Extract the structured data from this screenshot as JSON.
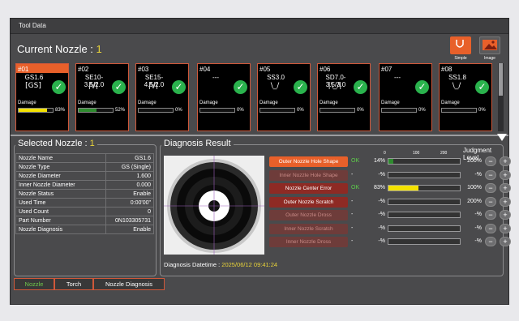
{
  "window": {
    "title": "Tool Data"
  },
  "header": {
    "label": "Current Nozzle : ",
    "value": "1"
  },
  "toolbar": {
    "simple_label": "Simple",
    "image_label": "Image"
  },
  "nozzles": [
    {
      "num": "#01",
      "name": "GS1.6",
      "shape": "[GS]",
      "damage_label": "Damage",
      "pct": "83%",
      "fill": 0.83,
      "fill_color": "#f3e100",
      "selected": true
    },
    {
      "num": "#02",
      "name": "SE10-3.5/2.0",
      "shape": "|\\/|",
      "damage_label": "Damage",
      "pct": "52%",
      "fill": 0.52,
      "fill_color": "#2e8b2e",
      "selected": false
    },
    {
      "num": "#03",
      "name": "SE15-4.5/2.0",
      "shape": "|\\/|",
      "damage_label": "Damage",
      "pct": "0%",
      "fill": 0,
      "fill_color": "#2e8b2e",
      "selected": false
    },
    {
      "num": "#04",
      "name": "---",
      "shape": "",
      "damage_label": "Damage",
      "pct": "0%",
      "fill": 0,
      "fill_color": "#2e8b2e",
      "selected": false
    },
    {
      "num": "#05",
      "name": "SS3.0",
      "shape": "\\_/",
      "damage_label": "Damage",
      "pct": "0%",
      "fill": 0,
      "fill_color": "#2e8b2e",
      "selected": false
    },
    {
      "num": "#06",
      "name": "SD7.0-3.5/3.0",
      "shape": "|\\_/|",
      "damage_label": "Damage",
      "pct": "0%",
      "fill": 0,
      "fill_color": "#2e8b2e",
      "selected": false
    },
    {
      "num": "#07",
      "name": "---",
      "shape": "",
      "damage_label": "Damage",
      "pct": "0%",
      "fill": 0,
      "fill_color": "#2e8b2e",
      "selected": false
    },
    {
      "num": "#08",
      "name": "SS1.8",
      "shape": "\\_/",
      "damage_label": "Damage",
      "pct": "0%",
      "fill": 0,
      "fill_color": "#2e8b2e",
      "selected": false
    }
  ],
  "selected": {
    "title": "Selected Nozzle : ",
    "value": "1",
    "rows": [
      {
        "label": "Nozzle Name",
        "value": "GS1.6"
      },
      {
        "label": "Nozzle Type",
        "value": "GS (Single)"
      },
      {
        "label": "Nozzle Diameter",
        "value": "1.600"
      },
      {
        "label": "Inner Nozzle Diameter",
        "value": "0.000"
      },
      {
        "label": "Nozzle Status",
        "value": "Enable"
      },
      {
        "label": "Used Time",
        "value": "0:00'00\""
      },
      {
        "label": "Used Count",
        "value": "0"
      },
      {
        "label": "Part Number",
        "value": "0N103305731"
      },
      {
        "label": "Nozzle Diagnosis",
        "value": "Enable"
      }
    ]
  },
  "diagnosis": {
    "title": "Diagnosis Result",
    "judgment_label": "Judgment Level",
    "scale": [
      "0",
      "100",
      "200"
    ],
    "rows": [
      {
        "label": "Outer Nozzle Hole Shape",
        "state": "on",
        "result": "OK",
        "pct": "14",
        "fill": 0.07,
        "fill_color": "#2e8b2e",
        "level": "200"
      },
      {
        "label": "Inner Nozzle Hole Shape",
        "state": "off",
        "result": "-",
        "pct": "-",
        "fill": 0,
        "fill_color": "#2e8b2e",
        "level": "-"
      },
      {
        "label": "Nozzle Center Error",
        "state": "err",
        "result": "OK",
        "pct": "83",
        "fill": 0.415,
        "fill_color": "#f3e100",
        "level": "100"
      },
      {
        "label": "Outer Nozzle Scratch",
        "state": "err",
        "result": "-",
        "pct": "-",
        "fill": 0,
        "fill_color": "#2e8b2e",
        "level": "200"
      },
      {
        "label": "Outer Nozzle Dross",
        "state": "off",
        "result": "-",
        "pct": "-",
        "fill": 0,
        "fill_color": "#2e8b2e",
        "level": "-"
      },
      {
        "label": "Inner Nozzle Scratch",
        "state": "off",
        "result": "-",
        "pct": "-",
        "fill": 0,
        "fill_color": "#2e8b2e",
        "level": "-"
      },
      {
        "label": "Inner Nozzle Dross",
        "state": "off",
        "result": "-",
        "pct": "-",
        "fill": 0,
        "fill_color": "#2e8b2e",
        "level": "-"
      }
    ],
    "pct_suffix": "%",
    "minus": "−",
    "plus": "+",
    "datetime_label": "Diagnosis Datetime : ",
    "datetime_value": "2025/06/12 09:41:24"
  },
  "tabs": [
    {
      "label": "Nozzle",
      "active": true
    },
    {
      "label": "Torch",
      "active": false
    },
    {
      "label": "Nozzle Diagnosis",
      "active": false
    }
  ]
}
